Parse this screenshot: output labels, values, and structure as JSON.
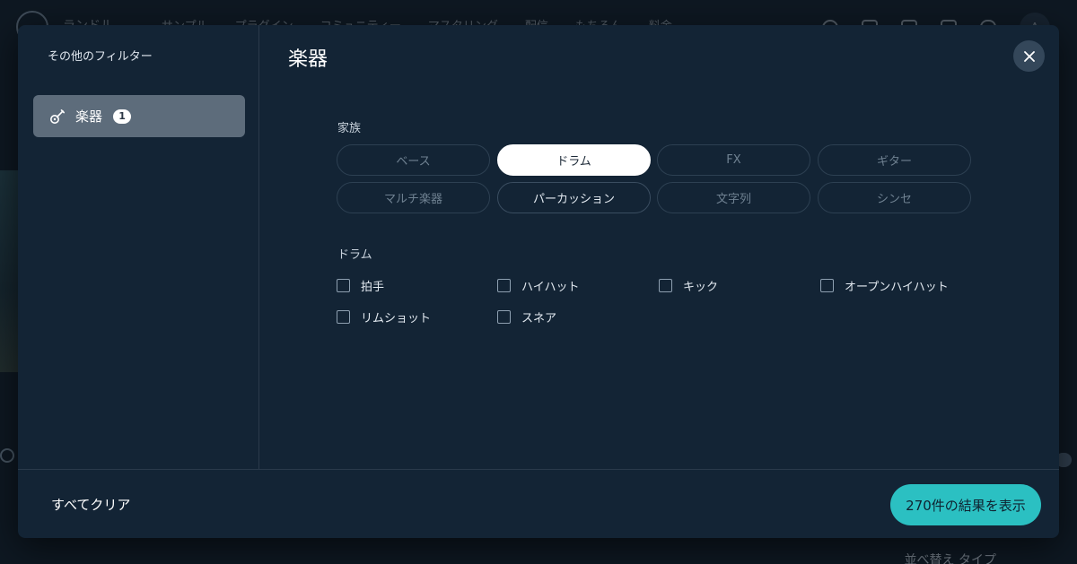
{
  "background": {
    "brand": "ランドル",
    "nav_links": [
      "サンプル",
      "プラグイン",
      "コミュニティー",
      "マスタリング",
      "配信",
      "もちろん",
      "料金"
    ],
    "avatar_letter": "A",
    "sort_text": "並べ替え タイプ"
  },
  "modal": {
    "sidebar": {
      "title": "その他のフィルター",
      "items": [
        {
          "label": "楽器",
          "count": "1",
          "icon": "guitar-icon"
        }
      ]
    },
    "title": "楽器",
    "family": {
      "label": "家族",
      "chips": [
        {
          "label": "ベース",
          "state": "inactive"
        },
        {
          "label": "ドラム",
          "state": "selected"
        },
        {
          "label": "FX",
          "state": "inactive"
        },
        {
          "label": "ギター",
          "state": "inactive"
        },
        {
          "label": "マルチ楽器",
          "state": "inactive"
        },
        {
          "label": "パーカッション",
          "state": "available"
        },
        {
          "label": "文字列",
          "state": "inactive"
        },
        {
          "label": "シンセ",
          "state": "inactive"
        }
      ]
    },
    "drum": {
      "label": "ドラム",
      "options": [
        {
          "label": "拍手",
          "checked": false
        },
        {
          "label": "ハイハット",
          "checked": false
        },
        {
          "label": "キック",
          "checked": false
        },
        {
          "label": "オープンハイハット",
          "checked": false
        },
        {
          "label": "リムショット",
          "checked": false
        },
        {
          "label": "スネア",
          "checked": false
        }
      ]
    },
    "footer": {
      "clear_label": "すべてクリア",
      "results_label": "270件の結果を表示"
    }
  },
  "colors": {
    "accent": "#2bc0c2",
    "modal_bg": "#132435",
    "sidebar_active": "#5d6c7b"
  }
}
